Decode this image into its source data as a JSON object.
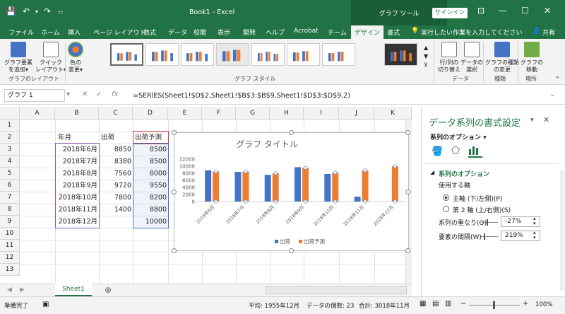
{
  "window": {
    "title": "Book1 - Excel",
    "context_tab": "グラフ ツール",
    "signin": "サインイン"
  },
  "tabs": [
    "ファイル",
    "ホーム",
    "挿入",
    "ページ レイアウト",
    "数式",
    "データ",
    "校閲",
    "表示",
    "開発",
    "ヘルプ",
    "Acrobat",
    "チーム",
    "デザイン",
    "書式"
  ],
  "tellme": "実行したい作業を入力してください",
  "share": "共有",
  "ribbon": {
    "buttons": [
      {
        "l1": "グラフ要素",
        "l2": "を追加▾"
      },
      {
        "l1": "クイック",
        "l2": "レイアウト▾"
      },
      {
        "l1": "色の",
        "l2": "変更▾"
      },
      {
        "l1": "行/列の",
        "l2": "切り替え"
      },
      {
        "l1": "データの",
        "l2": "選択"
      },
      {
        "l1": "グラフの種類",
        "l2": "の変更"
      },
      {
        "l1": "グラフの",
        "l2": "移動"
      }
    ],
    "groups": [
      "グラフのレイアウト",
      "グラフ スタイル",
      "データ",
      "種類",
      "場所"
    ]
  },
  "namebox": "グラフ 1",
  "formula": "=SERIES(Sheet1!$D$2,Sheet1!$B$3:$B$9,Sheet1!$D$3:$D$9,2)",
  "columns": [
    "A",
    "B",
    "C",
    "D",
    "E",
    "F",
    "G",
    "H",
    "I",
    "J",
    "K"
  ],
  "rows": [
    "1",
    "2",
    "3",
    "4",
    "5",
    "6",
    "7",
    "8",
    "9",
    "10",
    "11",
    "12",
    "13"
  ],
  "table": {
    "headers": [
      "年月",
      "出荷",
      "出荷予測"
    ],
    "rows": [
      [
        "2018年6月",
        "8850",
        "8500"
      ],
      [
        "2018年7月",
        "8380",
        "8500"
      ],
      [
        "2018年8月",
        "7560",
        "8000"
      ],
      [
        "2018年9月",
        "9720",
        "9550"
      ],
      [
        "2018年10月",
        "7800",
        "8200"
      ],
      [
        "2018年11月",
        "1400",
        "8800"
      ],
      [
        "2018年12月",
        "",
        "10000"
      ]
    ]
  },
  "chart_data": {
    "type": "bar",
    "title": "グラフ タイトル",
    "categories": [
      "2018年6月",
      "2018年7月",
      "2018年8月",
      "2018年9月",
      "2018年10月",
      "2018年11月",
      "2018年12月"
    ],
    "series": [
      {
        "name": "出荷",
        "color": "#4472C4",
        "values": [
          8850,
          8380,
          7560,
          9720,
          7800,
          1400,
          null
        ]
      },
      {
        "name": "出荷予測",
        "color": "#ED7D31",
        "values": [
          8500,
          8500,
          8000,
          9550,
          8200,
          8800,
          10000
        ]
      }
    ],
    "yticks": [
      "0",
      "2000",
      "4000",
      "6000",
      "8000",
      "10000",
      "12000"
    ],
    "ylim": [
      0,
      12000
    ],
    "legend": "bottom",
    "grid": false
  },
  "pane": {
    "title": "データ系列の書式設定",
    "options_label": "系列のオプション ▾",
    "section": "系列のオプション",
    "axis_label": "使用する軸",
    "radio_primary": "主軸 (下/左側)(P)",
    "radio_secondary": "第 2 軸 (上/右側)(S)",
    "overlap_label": "系列の重なり(O)",
    "overlap_value": "-27%",
    "gap_label": "要素の間隔(W)",
    "gap_value": "219%"
  },
  "sheet_tab": "Sheet1",
  "status": {
    "ready": "準備完了",
    "average": "平均: 1955年12月",
    "count": "データの個数: 23",
    "sum": "合計: 3018年11月",
    "zoom": "100%"
  }
}
